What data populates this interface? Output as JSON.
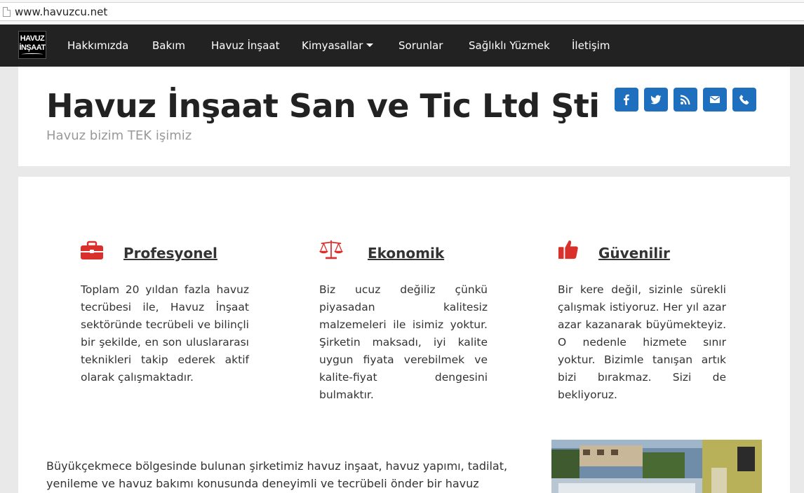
{
  "browser": {
    "url": "www.havuzcu.net"
  },
  "navbar": {
    "logo_line1": "HAVUZ",
    "logo_line2": "İNŞAAT",
    "items": [
      {
        "label": "Hakkımızda"
      },
      {
        "label": "Bakım"
      },
      {
        "label": "Havuz İnşaat"
      },
      {
        "label": "Kimyasallar"
      },
      {
        "label": "Sorunlar"
      },
      {
        "label": "Sağlıklı Yüzmek"
      },
      {
        "label": "İletişim"
      }
    ]
  },
  "header": {
    "title": "Havuz İnşaat San ve Tic Ltd Şti",
    "subtitle": "Havuz bizim TEK işimiz",
    "social": [
      {
        "icon": "facebook-icon"
      },
      {
        "icon": "twitter-icon"
      },
      {
        "icon": "rss-icon"
      },
      {
        "icon": "envelope-icon"
      },
      {
        "icon": "phone-icon"
      }
    ]
  },
  "features": [
    {
      "icon": "briefcase-icon",
      "title": "Profesyonel",
      "text": "Toplam 20 yıldan fazla havuz tecrübesi ile, Havuz İnşaat sektöründe tecrübeli ve bilinçli bir şekilde, en son uluslararası teknikleri takip ederek aktif olarak çalışmaktadır."
    },
    {
      "icon": "balance-scale-icon",
      "title": "Ekonomik",
      "text": "Biz ucuz değiliz çünkü piyasadan kalitesiz malzemeleri ile isimiz yoktur. Şirketin maksadı, iyi kalite uygun fiyata verebilmek ve kalite-fiyat dengesini bulmaktır."
    },
    {
      "icon": "thumbs-up-icon",
      "title": "Güvenilir",
      "text": "Bir kere değil, sizinle sürekli çalışmak istiyoruz. Her yıl azar azar kazanarak büyümekteyiz. O nedenle hizmete sınır yoktur. Bizimle tanışan artık bizi bırakmaz. Sizi de bekliyoruz."
    }
  ],
  "intro": {
    "text": "Büyükçekmece bölgesinde bulunan şirketimiz havuz inşaat, havuz yapımı, tadilat, yenileme ve havuz bakımı konusunda deneyimli ve tecrübeli önder bir havuz"
  },
  "colors": {
    "navbar": "#222222",
    "social_button": "#1f6fbf",
    "feature_icon": "#d9302c"
  }
}
